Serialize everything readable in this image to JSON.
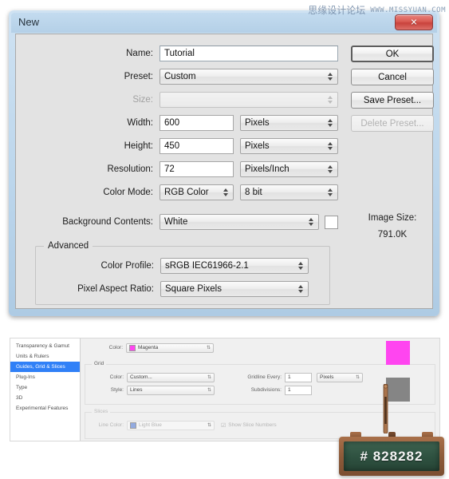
{
  "watermark": {
    "cn": "思缘设计论坛",
    "en": "WWW.MISSYUAN.COM"
  },
  "new_dialog": {
    "title": "New",
    "close_glyph": "✕",
    "fields": {
      "name_label": "Name:",
      "name_value": "Tutorial",
      "preset_label": "Preset:",
      "preset_value": "Custom",
      "size_label": "Size:",
      "size_value": "",
      "width_label": "Width:",
      "width_value": "600",
      "width_unit": "Pixels",
      "height_label": "Height:",
      "height_value": "450",
      "height_unit": "Pixels",
      "resolution_label": "Resolution:",
      "resolution_value": "72",
      "resolution_unit": "Pixels/Inch",
      "color_mode_label": "Color Mode:",
      "color_mode_value": "RGB Color",
      "color_depth_value": "8 bit",
      "background_label": "Background Contents:",
      "background_value": "White",
      "background_swatch_color": "#ffffff"
    },
    "advanced": {
      "legend": "Advanced",
      "color_profile_label": "Color Profile:",
      "color_profile_value": "sRGB IEC61966-2.1",
      "pixel_aspect_label": "Pixel Aspect Ratio:",
      "pixel_aspect_value": "Square Pixels"
    },
    "buttons": {
      "ok": "OK",
      "cancel": "Cancel",
      "save_preset": "Save Preset...",
      "delete_preset": "Delete Preset..."
    },
    "image_size": {
      "label": "Image Size:",
      "value": "791.0K"
    }
  },
  "prefs_panel": {
    "sidebar": [
      {
        "label": "Transparency & Gamut",
        "selected": false
      },
      {
        "label": "Units & Rulers",
        "selected": false
      },
      {
        "label": "Guides, Grid & Slices",
        "selected": true
      },
      {
        "label": "Plug-Ins",
        "selected": false
      },
      {
        "label": "Type",
        "selected": false
      },
      {
        "label": "3D",
        "selected": false
      },
      {
        "label": "Experimental Features",
        "selected": false
      }
    ],
    "guides": {
      "color_label": "Color:",
      "color_value": "Magenta",
      "color_hex": "#ff3ff0"
    },
    "grid": {
      "legend": "Grid",
      "color_label": "Color:",
      "color_value": "Custom...",
      "style_label": "Style:",
      "style_value": "Lines",
      "gridline_every_label": "Gridline Every:",
      "gridline_every_value": "1",
      "gridline_unit": "Pixels",
      "subdivisions_label": "Subdivisions:",
      "subdivisions_value": "1"
    },
    "slices": {
      "legend": "Slices",
      "line_color_label": "Line Color:",
      "line_color_value": "Light Blue",
      "line_color_hex": "#8fa8e0",
      "show_numbers_label": "Show Slice Numbers",
      "show_numbers_checked": true
    },
    "swatches": {
      "magenta_hex": "#ff3ff0",
      "gray_hex": "#828282"
    }
  },
  "chalkboard": {
    "text": "# 828282"
  }
}
